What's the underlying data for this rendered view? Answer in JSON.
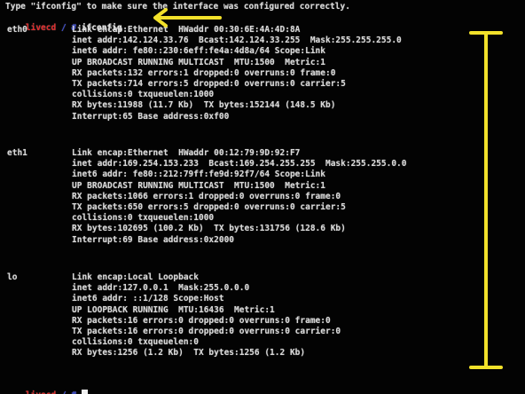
{
  "instruction": "Type \"ifconfig\" to make sure the interface was configured correctly.",
  "prompt1": {
    "host": "livecd",
    "sep": " / # ",
    "command": "ifconfig"
  },
  "interfaces": [
    {
      "name": "eth0",
      "lines": [
        "Link encap:Ethernet  HWaddr 00:30:6E:4A:4D:8A",
        "inet addr:142.124.33.76  Bcast:142.124.33.255  Mask:255.255.255.0",
        "inet6 addr: fe80::230:6eff:fe4a:4d8a/64 Scope:Link",
        "UP BROADCAST RUNNING MULTICAST  MTU:1500  Metric:1",
        "RX packets:132 errors:1 dropped:0 overruns:0 frame:0",
        "TX packets:714 errors:5 dropped:0 overruns:0 carrier:5",
        "collisions:0 txqueuelen:1000",
        "RX bytes:11988 (11.7 Kb)  TX bytes:152144 (148.5 Kb)",
        "Interrupt:65 Base address:0xf00"
      ]
    },
    {
      "name": "eth1",
      "lines": [
        "Link encap:Ethernet  HWaddr 00:12:79:9D:92:F7",
        "inet addr:169.254.153.233  Bcast:169.254.255.255  Mask:255.255.0.0",
        "inet6 addr: fe80::212:79ff:fe9d:92f7/64 Scope:Link",
        "UP BROADCAST RUNNING MULTICAST  MTU:1500  Metric:1",
        "RX packets:1066 errors:1 dropped:0 overruns:0 frame:0",
        "TX packets:650 errors:5 dropped:0 overruns:0 carrier:5",
        "collisions:0 txqueuelen:1000",
        "RX bytes:102695 (100.2 Kb)  TX bytes:131756 (128.6 Kb)",
        "Interrupt:69 Base address:0x2000"
      ]
    },
    {
      "name": "lo",
      "lines": [
        "Link encap:Local Loopback",
        "inet addr:127.0.0.1  Mask:255.0.0.0",
        "inet6 addr: ::1/128 Scope:Host",
        "UP LOOPBACK RUNNING  MTU:16436  Metric:1",
        "RX packets:16 errors:0 dropped:0 overruns:0 frame:0",
        "TX packets:16 errors:0 dropped:0 overruns:0 carrier:0",
        "collisions:0 txqueuelen:0",
        "RX bytes:1256 (1.2 Kb)  TX bytes:1256 (1.2 Kb)"
      ]
    }
  ],
  "prompt2": {
    "host": "livecd",
    "sep": " / # "
  },
  "annotation_color": "#f2e12a"
}
